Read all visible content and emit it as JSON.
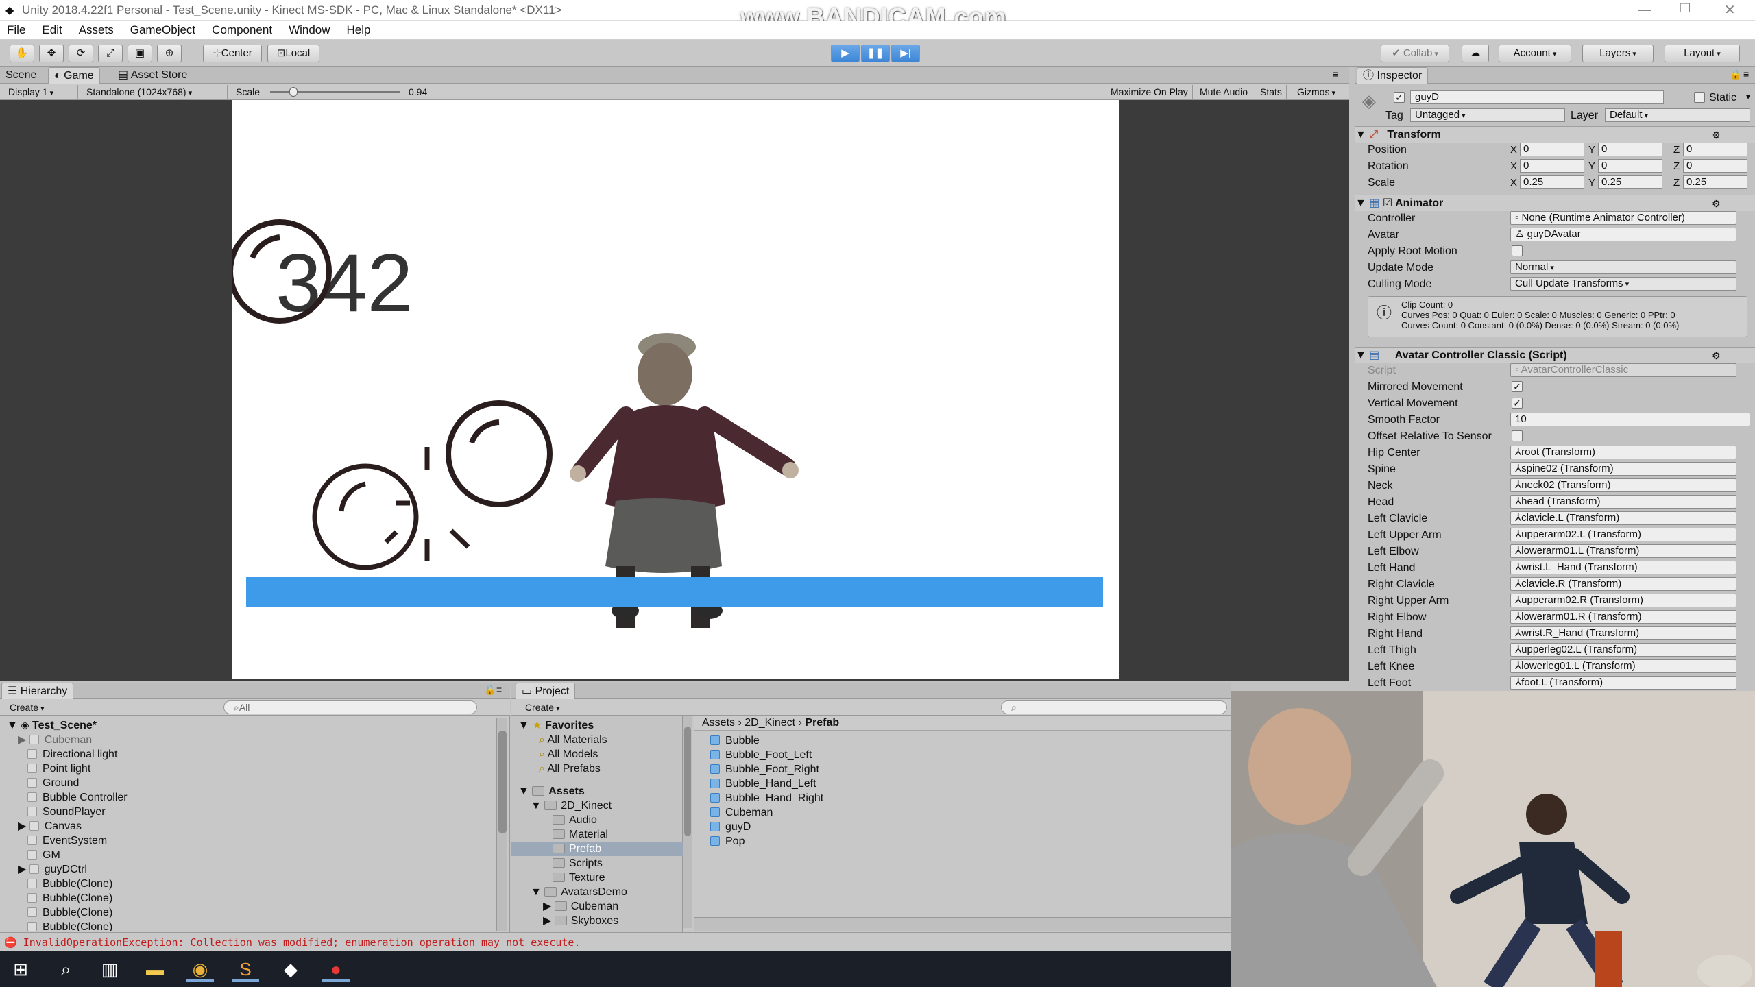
{
  "window": {
    "title": "Unity 2018.4.22f1 Personal - Test_Scene.unity - Kinect MS-SDK - PC, Mac & Linux Standalone* <DX11>",
    "watermark": "www.BANDICAM.com"
  },
  "menu": [
    "File",
    "Edit",
    "Assets",
    "GameObject",
    "Component",
    "Window",
    "Help"
  ],
  "toolbar": {
    "pivot": "Center",
    "space": "Local",
    "collab": "Collab",
    "account": "Account",
    "layers": "Layers",
    "layout": "Layout"
  },
  "game_panel": {
    "tabs": [
      "Scene",
      "Game",
      "Asset Store"
    ],
    "display": "Display 1",
    "resolution": "Standalone (1024x768)",
    "scale_label": "Scale",
    "scale_value": "0.94",
    "scale_fraction": 0.18,
    "buttons": [
      "Maximize On Play",
      "Mute Audio",
      "Stats",
      "Gizmos"
    ],
    "score": "342",
    "ground_color": "#3d9be9"
  },
  "hierarchy": {
    "tab": "Hierarchy",
    "create": "Create",
    "search_placeholder": "All",
    "scene": "Test_Scene*",
    "items": [
      "Cubeman",
      "Directional light",
      "Point light",
      "Ground",
      "Bubble Controller",
      "SoundPlayer",
      "Canvas",
      "EventSystem",
      "GM",
      "guyDCtrl",
      "Bubble(Clone)",
      "Bubble(Clone)",
      "Bubble(Clone)",
      "Bubble(Clone)"
    ]
  },
  "project": {
    "tab": "Project",
    "create": "Create",
    "favorites_label": "Favorites",
    "favorites": [
      "All Materials",
      "All Models",
      "All Prefabs"
    ],
    "assets_label": "Assets",
    "tree": [
      "2D_Kinect",
      "Audio",
      "Material",
      "Prefab",
      "Scripts",
      "Texture",
      "AvatarsDemo",
      "Cubeman",
      "Skyboxes"
    ],
    "breadcrumb": [
      "Assets",
      "2D_Kinect",
      "Prefab"
    ],
    "files": [
      "Bubble",
      "Bubble_Foot_Left",
      "Bubble_Foot_Right",
      "Bubble_Hand_Left",
      "Bubble_Hand_Right",
      "Cubeman",
      "guyD",
      "Pop"
    ]
  },
  "inspector": {
    "tab": "Inspector",
    "object_name": "guyD",
    "static_label": "Static",
    "tag_label": "Tag",
    "tag_value": "Untagged",
    "layer_label": "Layer",
    "layer_value": "Default",
    "transform": {
      "title": "Transform",
      "position_label": "Position",
      "rotation_label": "Rotation",
      "scale_label": "Scale",
      "position": [
        "0",
        "0",
        "0"
      ],
      "rotation": [
        "0",
        "0",
        "0"
      ],
      "scale": [
        "0.25",
        "0.25",
        "0.25"
      ]
    },
    "animator": {
      "title": "Animator",
      "controller_label": "Controller",
      "controller": "None (Runtime Animator Controller)",
      "avatar_label": "Avatar",
      "avatar": "guyDAvatar",
      "apply_root_label": "Apply Root Motion",
      "update_mode_label": "Update Mode",
      "update_mode": "Normal",
      "culling_mode_label": "Culling Mode",
      "culling_mode": "Cull Update Transforms",
      "info1": "Clip Count: 0",
      "info2": "Curves Pos: 0 Quat: 0 Euler: 0 Scale: 0 Muscles: 0 Generic: 0 PPtr: 0",
      "info3": "Curves Count: 0 Constant: 0 (0.0%) Dense: 0 (0.0%) Stream: 0 (0.0%)"
    },
    "avatar_controller": {
      "title": "Avatar Controller Classic (Script)",
      "script_label": "Script",
      "script": "AvatarControllerClassic",
      "mirrored_label": "Mirrored Movement",
      "vertical_label": "Vertical Movement",
      "smooth_label": "Smooth Factor",
      "smooth_value": "10",
      "offset_label": "Offset Relative To Sensor",
      "bones": [
        {
          "label": "Hip Center",
          "value": "root (Transform)"
        },
        {
          "label": "Spine",
          "value": "spine02 (Transform)"
        },
        {
          "label": "Neck",
          "value": "neck02 (Transform)"
        },
        {
          "label": "Head",
          "value": "head (Transform)"
        },
        {
          "label": "Left Clavicle",
          "value": "clavicle.L (Transform)"
        },
        {
          "label": "Left Upper Arm",
          "value": "upperarm02.L (Transform)"
        },
        {
          "label": "Left Elbow",
          "value": "lowerarm01.L (Transform)"
        },
        {
          "label": "Left Hand",
          "value": "wrist.L_Hand (Transform)"
        },
        {
          "label": "Right Clavicle",
          "value": "clavicle.R (Transform)"
        },
        {
          "label": "Right Upper Arm",
          "value": "upperarm02.R (Transform)"
        },
        {
          "label": "Right Elbow",
          "value": "lowerarm01.R (Transform)"
        },
        {
          "label": "Right Hand",
          "value": "wrist.R_Hand (Transform)"
        },
        {
          "label": "Left Thigh",
          "value": "upperleg02.L (Transform)"
        },
        {
          "label": "Left Knee",
          "value": "lowerleg01.L (Transform)"
        },
        {
          "label": "Left Foot",
          "value": "foot.L (Transform)"
        }
      ]
    }
  },
  "status": {
    "message": "InvalidOperationException: Collection was modified; enumeration operation may not execute."
  }
}
